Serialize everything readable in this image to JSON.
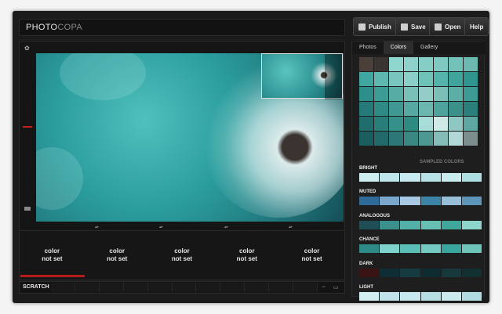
{
  "app": {
    "logo_bold": "PHOTO",
    "logo_light": "COPA"
  },
  "toolbar": {
    "publish_label": "Publish",
    "save_label": "Save",
    "open_label": "Open",
    "help_label": "Help"
  },
  "editor": {
    "color_slots": [
      {
        "line1": "color",
        "line2": "not set"
      },
      {
        "line1": "color",
        "line2": "not set"
      },
      {
        "line1": "color",
        "line2": "not set"
      },
      {
        "line1": "color",
        "line2": "not set"
      },
      {
        "line1": "color",
        "line2": "not set"
      }
    ],
    "scratch_label": "SCRATCH"
  },
  "panel": {
    "tabs": [
      "Photos",
      "Colors",
      "Gallery"
    ],
    "active_tab": "Colors",
    "sampled_label": "SAMPLED COLORS",
    "sampled_colors": [
      "#4b3f3a",
      "#3a3430",
      "#8fd6cf",
      "#8fd2cc",
      "#86cdc6",
      "#7fc9c2",
      "#73c2ba",
      "#6bb9b1",
      "#3fa6a0",
      "#5fb8b0",
      "#79c6be",
      "#8bd0c8",
      "#6ec2b8",
      "#54b3aa",
      "#3fa49c",
      "#2f958e",
      "#2c8f8a",
      "#3c9c96",
      "#56ada6",
      "#7bc0b8",
      "#93ccc6",
      "#7bbfb8",
      "#5caea6",
      "#3e9b94",
      "#237a78",
      "#2f8a86",
      "#3f9892",
      "#55a9a2",
      "#6cb6b0",
      "#4fa39d",
      "#3a918b",
      "#2a7f7a",
      "#1f6d6c",
      "#2a7e7a",
      "#36908a",
      "#2f8a84",
      "#a7dcd8",
      "#cfe9e7",
      "#8fc8c3",
      "#5ea7a2",
      "#1a5e60",
      "#226a6a",
      "#2c7876",
      "#3a8884",
      "#4e9893",
      "#86bcb8",
      "#b3d7d4",
      "#7c8e8d"
    ],
    "harmonies": [
      {
        "label": "BRIGHT",
        "colors": [
          "#cfeef0",
          "#bfe6ea",
          "#c6eaee",
          "#b8e3e6",
          "#c9ecef",
          "#aedfe2"
        ]
      },
      {
        "label": "MUTED",
        "colors": [
          "#2f6b98",
          "#7aa8cc",
          "#a7c8e2",
          "#3c83a8",
          "#97bfd8",
          "#5e95bb"
        ]
      },
      {
        "label": "ANALOGOUS",
        "colors": [
          "#1f4f54",
          "#3b8f8c",
          "#52b0a8",
          "#66c0b4",
          "#3fa79c",
          "#8ed6cc"
        ]
      },
      {
        "label": "CHANCE",
        "colors": [
          "#2d8a86",
          "#7fd3cd",
          "#5bbeb4",
          "#73cac2",
          "#3aa59d",
          "#6cc4bb"
        ]
      },
      {
        "label": "DARK",
        "colors": [
          "#3a1414",
          "#0f2e33",
          "#153a3f",
          "#0e2b2f",
          "#17393c",
          "#12302f"
        ]
      },
      {
        "label": "LIGHT",
        "colors": [
          "#d2eef0",
          "#bfe3e8",
          "#c7e9ee",
          "#b6dfe4",
          "#cbeaed",
          "#b0dbe0"
        ]
      }
    ]
  }
}
